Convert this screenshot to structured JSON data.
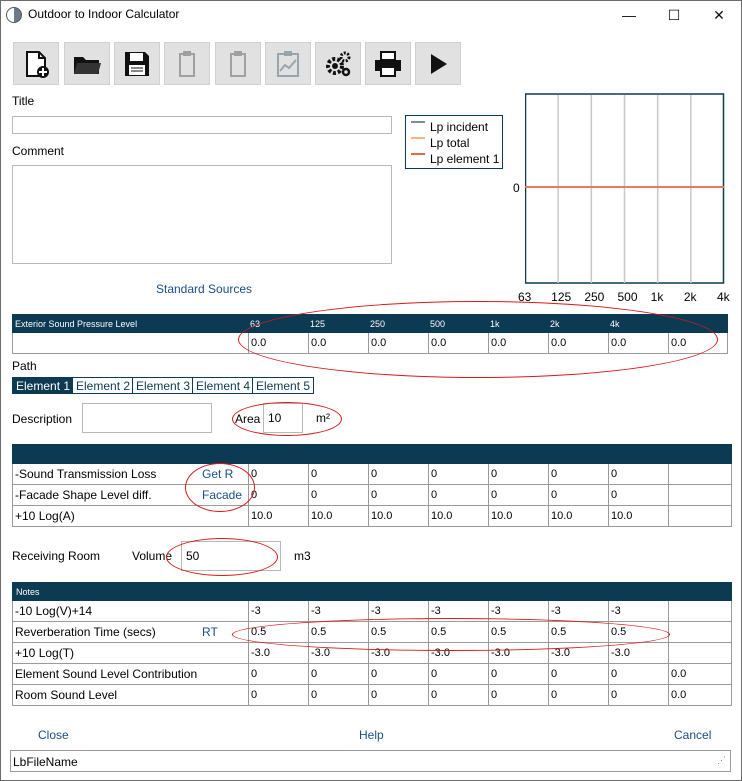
{
  "window": {
    "title": "Outdoor to Indoor Calculator",
    "min": "—",
    "max": "☐",
    "close": "✕"
  },
  "toolbar": {
    "buttons": [
      {
        "name": "new-document-button",
        "enabled": true
      },
      {
        "name": "open-folder-button",
        "enabled": true
      },
      {
        "name": "save-button",
        "enabled": true
      },
      {
        "name": "copy-button",
        "enabled": false
      },
      {
        "name": "paste-button",
        "enabled": false
      },
      {
        "name": "paste-chart-button",
        "enabled": false
      },
      {
        "name": "settings-button",
        "enabled": true
      },
      {
        "name": "print-button",
        "enabled": true
      },
      {
        "name": "run-button",
        "enabled": true
      }
    ]
  },
  "form": {
    "title_label": "Title",
    "title_value": "",
    "comment_label": "Comment",
    "comment_value": "",
    "standard_sources": "Standard Sources"
  },
  "chart_data": {
    "type": "line",
    "categories": [
      "63",
      "125",
      "250",
      "500",
      "1k",
      "2k",
      "4k"
    ],
    "y_tick": "0",
    "series": [
      {
        "name": "Lp incident",
        "color": "#7a8f9e",
        "values": [
          0,
          0,
          0,
          0,
          0,
          0,
          0
        ]
      },
      {
        "name": "Lp total",
        "color": "#f2b482",
        "values": [
          0,
          0,
          0,
          0,
          0,
          0,
          0
        ]
      },
      {
        "name": "Lp element 1",
        "color": "#e8674a",
        "values": [
          0,
          0,
          0,
          0,
          0,
          0,
          0
        ]
      }
    ],
    "legend_position": "top-left"
  },
  "exterior": {
    "header_label": "Exterior Sound Pressure Level",
    "freqs": [
      "63",
      "125",
      "250",
      "500",
      "1k",
      "2k",
      "4k"
    ],
    "values": [
      "0.0",
      "0.0",
      "0.0",
      "0.0",
      "0.0",
      "0.0",
      "0.0",
      "0.0"
    ]
  },
  "path": {
    "label": "Path",
    "tabs": [
      "Element 1",
      "Element 2",
      "Element 3",
      "Element 4",
      "Element 5"
    ],
    "active_tab": 0,
    "description_label": "Description",
    "description_value": "",
    "area_label": "Area",
    "area_value": "10",
    "area_unit": "m²"
  },
  "element_grid": {
    "rows": [
      {
        "label": "-Sound Transmission Loss",
        "link": "Get R",
        "values": [
          "0",
          "0",
          "0",
          "0",
          "0",
          "0",
          "0",
          ""
        ]
      },
      {
        "label": "-Facade Shape Level diff.",
        "link": "Facade",
        "values": [
          "0",
          "0",
          "0",
          "0",
          "0",
          "0",
          "0",
          ""
        ]
      },
      {
        "label": "+10 Log(A)",
        "link": "",
        "values": [
          "10.0",
          "10.0",
          "10.0",
          "10.0",
          "10.0",
          "10.0",
          "10.0",
          ""
        ]
      }
    ]
  },
  "room": {
    "label": "Receiving Room",
    "volume_label": "Volume",
    "volume_value": "50",
    "volume_unit": "m3"
  },
  "room_grid": {
    "header_label": "Notes",
    "rows": [
      {
        "label": "-10 Log(V)+14",
        "link": "",
        "values": [
          "-3",
          "-3",
          "-3",
          "-3",
          "-3",
          "-3",
          "-3",
          ""
        ]
      },
      {
        "label": "Reverberation Time (secs)",
        "link": "RT",
        "values": [
          "0.5",
          "0.5",
          "0.5",
          "0.5",
          "0.5",
          "0.5",
          "0.5",
          ""
        ]
      },
      {
        "label": "+10 Log(T)",
        "link": "",
        "values": [
          "-3.0",
          "-3.0",
          "-3.0",
          "-3.0",
          "-3.0",
          "-3.0",
          "-3.0",
          ""
        ]
      },
      {
        "label": "Element Sound Level Contribution",
        "link": "",
        "values": [
          "0",
          "0",
          "0",
          "0",
          "0",
          "0",
          "0",
          "0.0"
        ]
      },
      {
        "label": "Room Sound Level",
        "link": "",
        "values": [
          "0",
          "0",
          "0",
          "0",
          "0",
          "0",
          "0",
          "0.0"
        ]
      }
    ]
  },
  "footer": {
    "close": "Close",
    "help": "Help",
    "cancel": "Cancel",
    "status": "LbFileName"
  },
  "colors": {
    "header_bg": "#0b3a52",
    "link": "#1a4f86",
    "annotation": "#d91919"
  }
}
